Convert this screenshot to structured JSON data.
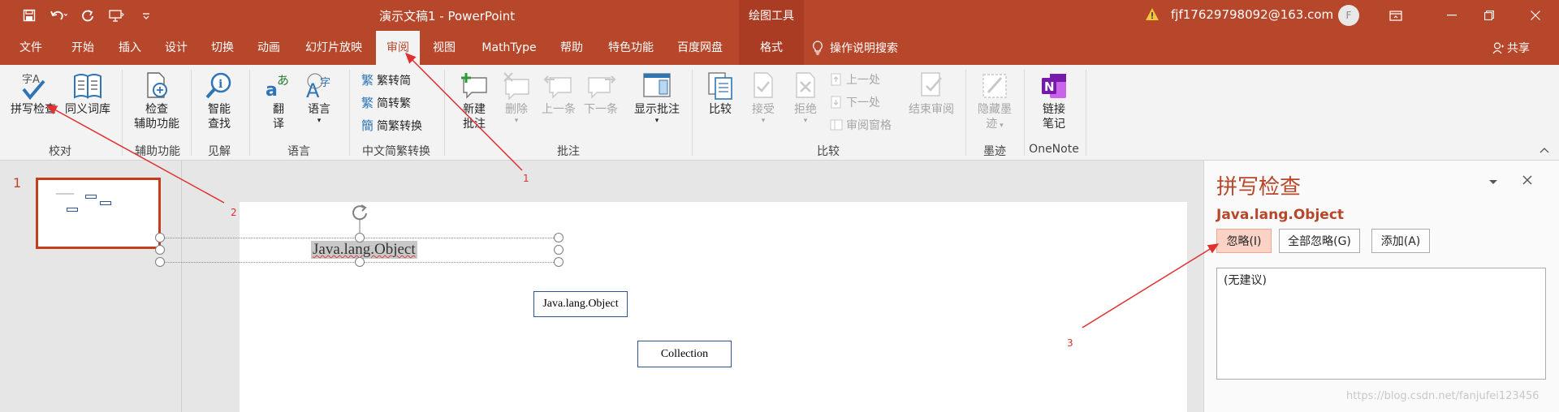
{
  "window": {
    "title": "演示文稿1  -  PowerPoint",
    "context_tab": "绘图工具",
    "account": "fjf17629798092@163.com",
    "avatar_initial": "F"
  },
  "tabs": [
    "文件",
    "开始",
    "插入",
    "设计",
    "切换",
    "动画",
    "幻灯片放映",
    "审阅",
    "视图",
    "MathType",
    "帮助",
    "特色功能",
    "百度网盘",
    "格式"
  ],
  "active_tab": "审阅",
  "tell_me": "操作说明搜索",
  "share": "共享",
  "ribbon": {
    "groups": {
      "proofing": "校对",
      "accessibility": "辅助功能",
      "insights": "见解",
      "language": "语言",
      "chinese_conv": "中文简繁转换",
      "comments": "批注",
      "compare": "比较",
      "ink": "墨迹",
      "onenote": "OneNote"
    },
    "buttons": {
      "spelling": "拼写检查",
      "thesaurus": "同义词库",
      "check_line1": "检查",
      "check_line2": "辅助功能",
      "smart_line1": "智能",
      "smart_line2": "查找",
      "translate_line1": "翻",
      "translate_line2": "译",
      "language": "语言",
      "trad_to_simp": "繁转简",
      "simp_to_trad": "简转繁",
      "conv": "简繁转换",
      "new_comment_line1": "新建",
      "new_comment_line2": "批注",
      "delete": "删除",
      "previous": "上一条",
      "next": "下一条",
      "show_comments": "显示批注",
      "compare": "比较",
      "accept": "接受",
      "reject": "拒绝",
      "prev_change": "上一处",
      "next_change": "下一处",
      "review_pane": "审阅窗格",
      "end_review": "结束审阅",
      "hide_ink_line1": "隐藏墨",
      "hide_ink_line2": "迹",
      "linked_notes_line1": "链接",
      "linked_notes_line2": "笔记"
    }
  },
  "slides": {
    "number": "1"
  },
  "slide_content": {
    "selected_text": "Java.lang.Object",
    "box1": "Java.lang.Object",
    "box2": "Collection"
  },
  "spelling_pane": {
    "title": "拼写检查",
    "word": "Java.lang.Object",
    "ignore": "忽略(I)",
    "ignore_all": "全部忽略(G)",
    "add": "添加(A)",
    "no_suggestions": "(无建议)"
  },
  "annotations": [
    "1",
    "2",
    "3"
  ],
  "watermark": "https://blog.csdn.net/fanjufei123456",
  "colors": {
    "accent": "#b7472a",
    "arrow": "#e03030"
  }
}
